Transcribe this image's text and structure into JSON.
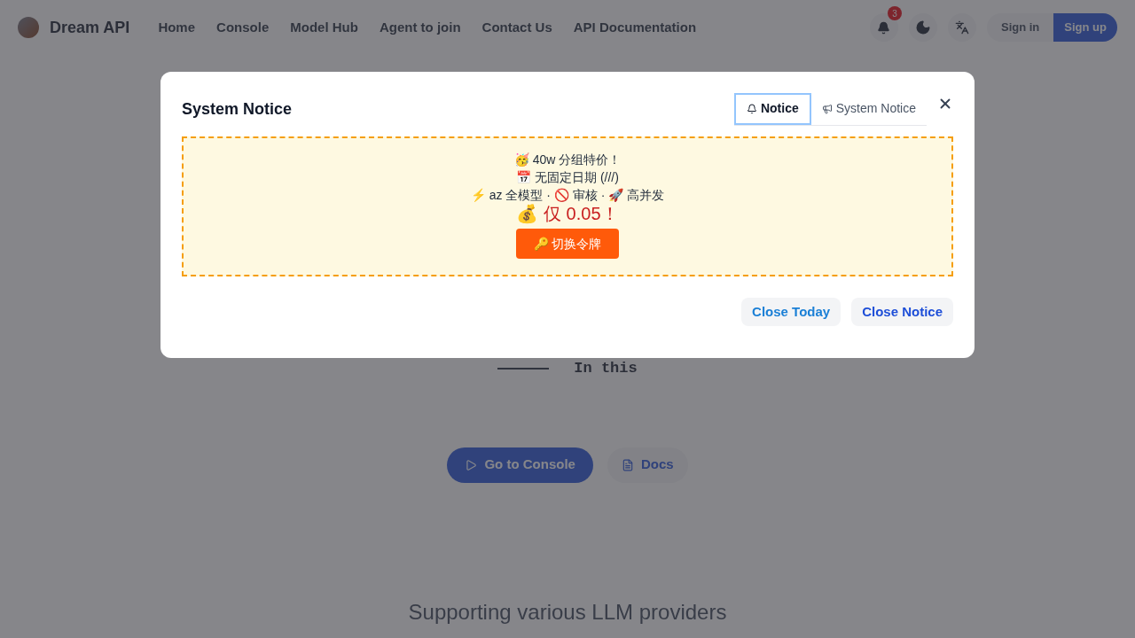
{
  "header": {
    "brand": "Dream API",
    "nav": [
      {
        "label": "Home"
      },
      {
        "label": "Console"
      },
      {
        "label": "Model Hub"
      },
      {
        "label": "Agent to join"
      },
      {
        "label": "Contact Us"
      },
      {
        "label": "API Documentation"
      }
    ],
    "notification_count": "3",
    "sign_in": "Sign in",
    "sign_up": "Sign up"
  },
  "hero": {
    "typing_text": "In this",
    "primary_button": "Go to Console",
    "secondary_button": "Docs",
    "providers_heading": "Supporting various LLM providers"
  },
  "dialog": {
    "title": "System Notice",
    "tabs": [
      {
        "label": "Notice",
        "selected": true
      },
      {
        "label": "System Notice",
        "selected": false
      }
    ],
    "notice_lines": [
      {
        "kind": "line",
        "text": "🥳 40w 分组特价！"
      },
      {
        "kind": "line",
        "text": "📅 无固定日期 (///)"
      },
      {
        "kind": "line",
        "text": "⚡ az 全模型 · 🚫 审核 · 🚀 高并发"
      },
      {
        "kind": "price",
        "text": "💰 仅 0.05！"
      }
    ],
    "action_button": "🔑 切换令牌",
    "close_today": "Close Today",
    "close_notice": "Close Notice"
  }
}
